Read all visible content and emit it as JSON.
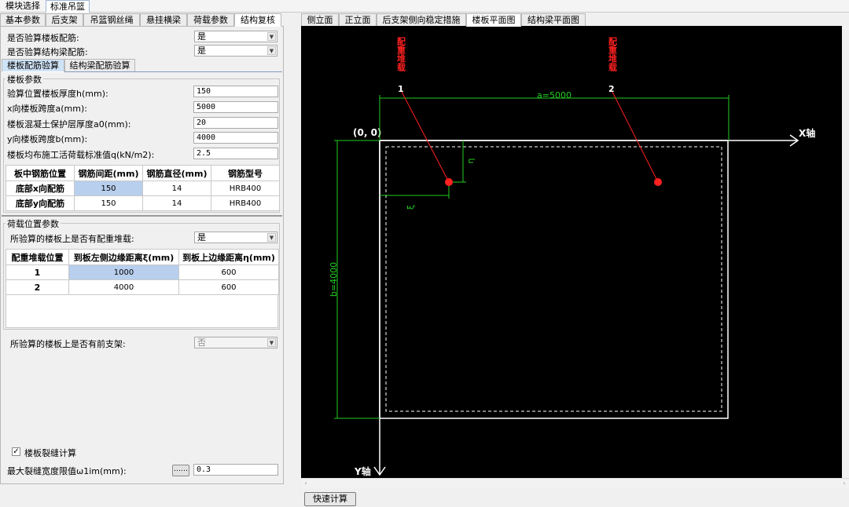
{
  "topbar": {
    "items": [
      "模块选择",
      "标准吊篮"
    ]
  },
  "left_tabs": [
    "基本参数",
    "后支架",
    "吊篮钢丝绳",
    "悬挂横梁",
    "荷载参数",
    "结构复核"
  ],
  "top_options": [
    {
      "label": "是否验算楼板配筋:",
      "value": "是"
    },
    {
      "label": "是否验算结构梁配筋:",
      "value": "是"
    }
  ],
  "sub_tabs": [
    "楼板配筋验算",
    "结构梁配筋验算"
  ],
  "slab_group": {
    "title": "楼板参数",
    "params": [
      {
        "label": "验算位置楼板厚度h(mm):",
        "value": "150"
      },
      {
        "label": "x向楼板跨度a(mm):",
        "value": "5000"
      },
      {
        "label": "楼板混凝土保护层厚度a0(mm):",
        "value": "20"
      },
      {
        "label": "y向楼板跨度b(mm):",
        "value": "4000"
      },
      {
        "label": "楼板均布施工活荷载标准值q(kN/m2):",
        "value": "2.5"
      }
    ],
    "rebar_table": {
      "headers": [
        "板中钢筋位置",
        "钢筋间距(mm)",
        "钢筋直径(mm)",
        "钢筋型号"
      ],
      "rows": [
        [
          "底部x向配筋",
          "150",
          "14",
          "HRB400"
        ],
        [
          "底部y向配筋",
          "150",
          "14",
          "HRB400"
        ]
      ]
    }
  },
  "load_group": {
    "title": "荷载位置参数",
    "q1_label": "所验算的楼板上是否有配重堆载:",
    "q1_value": "是",
    "table": {
      "headers": [
        "配重堆载位置",
        "到板左侧边缘距离ξ(mm)",
        "到板上边缘距离η(mm)"
      ],
      "rows": [
        [
          "1",
          "1000",
          "600"
        ],
        [
          "2",
          "4000",
          "600"
        ]
      ]
    },
    "q2_label": "所验算的楼板上是否有前支架:",
    "q2_value": "否"
  },
  "crack": {
    "checkbox_label": "楼板裂缝计算",
    "checked": true,
    "mark": "✓",
    "limit_label": "最大裂缝宽度限值ω1im(mm):",
    "limit_btn": "……",
    "limit_value": "0.3"
  },
  "right_tabs": [
    "侧立面",
    "正立面",
    "后支架侧向稳定措施",
    "楼板平面图",
    "结构梁平面图"
  ],
  "drawing": {
    "load_text": "配重堆载",
    "load1_no": "1",
    "load2_no": "2",
    "a_label": "a=5000",
    "b_label": "b=4000",
    "origin_label": "(0, 0)",
    "x_axis_label": "X轴",
    "y_axis_label": "Y轴",
    "eta_symbol": "η",
    "xi_symbol": "ξ",
    "colors": {
      "dim": "#22cc22",
      "load": "#ff2020",
      "line": "#ffffff",
      "bg": "#000000"
    }
  },
  "quick_calc_button": "快速计算"
}
